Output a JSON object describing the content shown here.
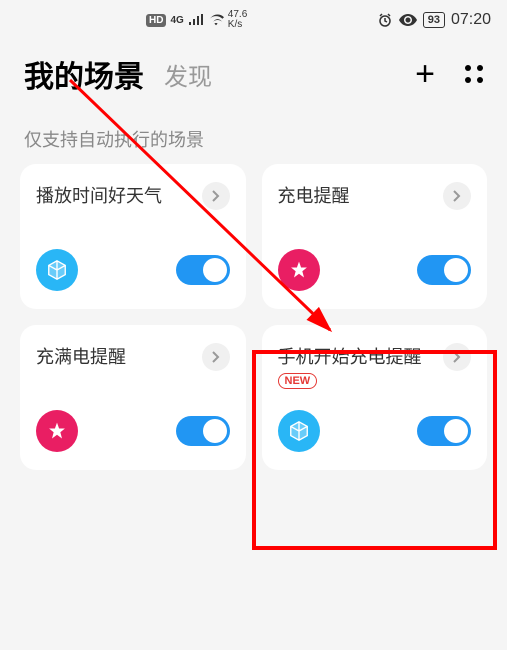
{
  "status": {
    "hd": "HD",
    "network": "4G",
    "speed_top": "47.6",
    "speed_bottom": "K/s",
    "battery": "93",
    "time": "07:20"
  },
  "header": {
    "active_tab": "我的场景",
    "inactive_tab": "发现"
  },
  "section": {
    "label": "仅支持自动执行的场景"
  },
  "cards": [
    {
      "title": "播放时间好天气",
      "icon_type": "cube",
      "icon_color": "blue",
      "toggle": true,
      "badge": null
    },
    {
      "title": "充电提醒",
      "icon_type": "star",
      "icon_color": "pink",
      "toggle": true,
      "badge": null
    },
    {
      "title": "充满电提醒",
      "icon_type": "star",
      "icon_color": "pink",
      "toggle": true,
      "badge": null
    },
    {
      "title": "手机开始充电提醒",
      "icon_type": "cube",
      "icon_color": "blue",
      "toggle": true,
      "badge": "NEW"
    }
  ],
  "annotation": {
    "highlight_card_index": 3
  }
}
